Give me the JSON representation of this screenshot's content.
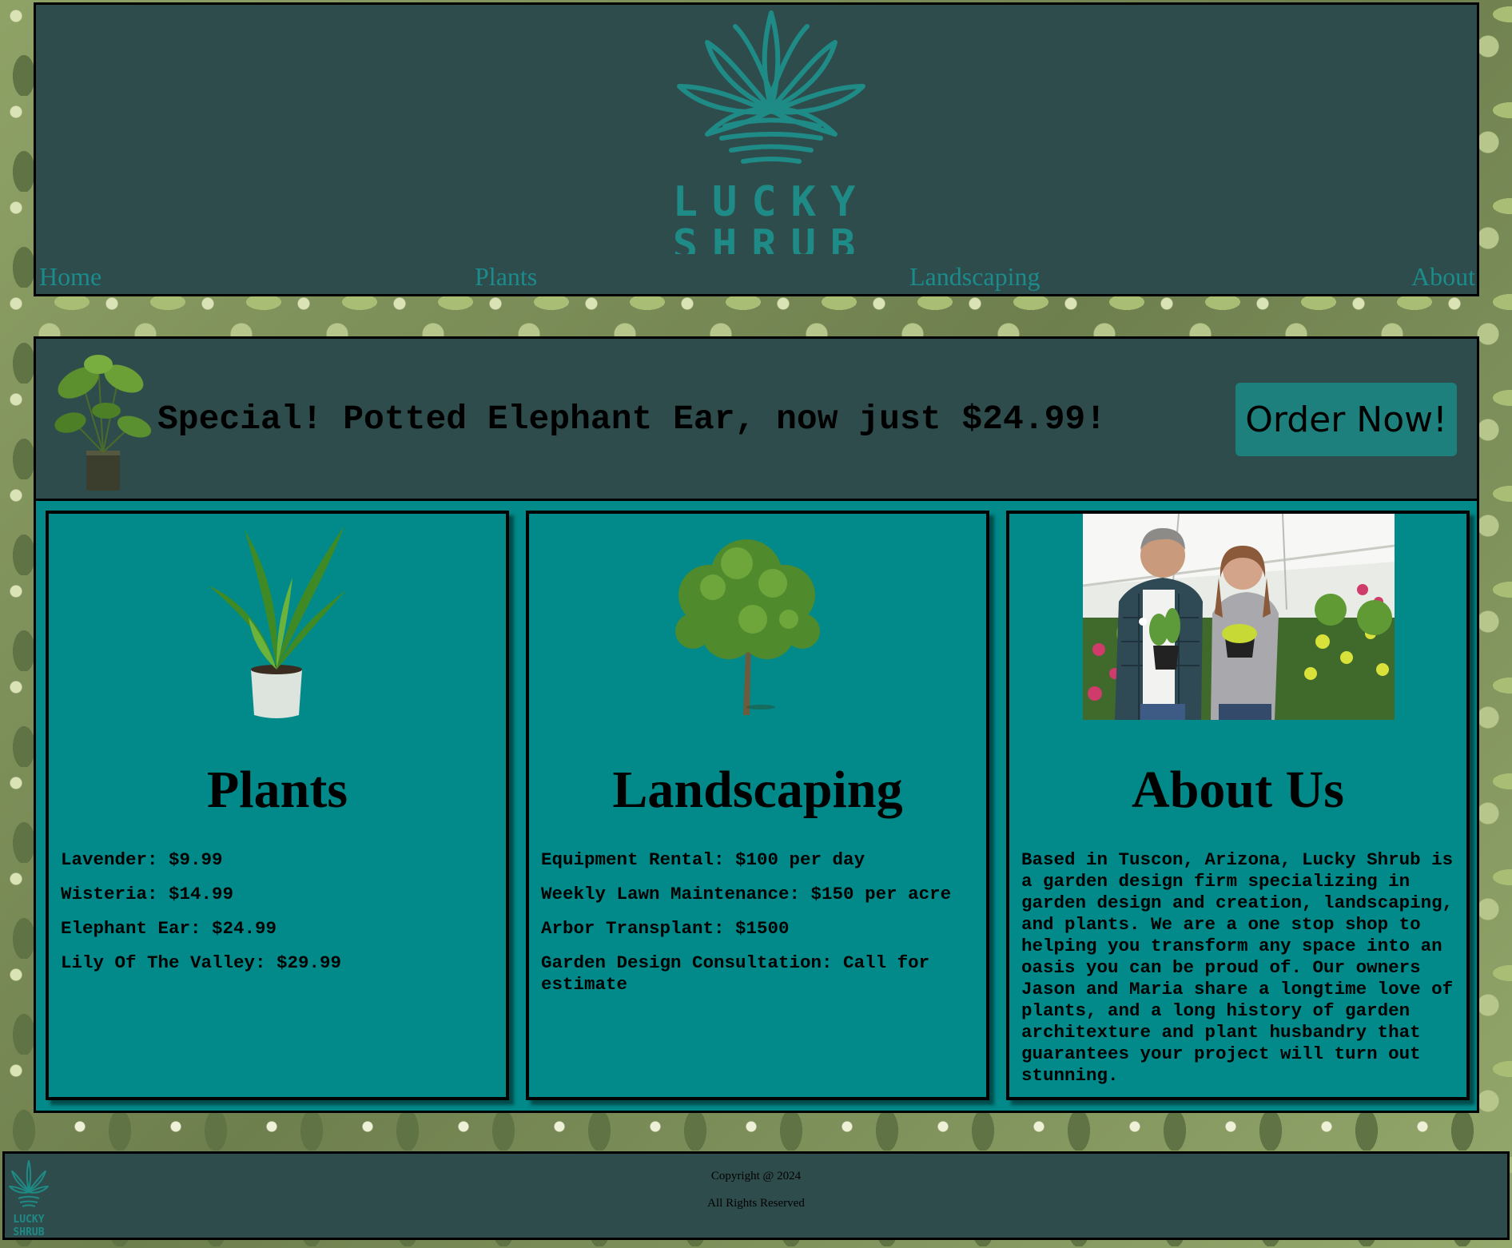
{
  "brand": {
    "line1": "LUCKY",
    "line2": "SHRUB",
    "logo_icon": "agave-plant-logo"
  },
  "nav": {
    "home": "Home",
    "plants": "Plants",
    "landscaping": "Landscaping",
    "about": "About"
  },
  "promo": {
    "text": "Special! Potted Elephant Ear, now just $24.99!",
    "button": "Order Now!"
  },
  "cards": {
    "plants": {
      "title": "Plants",
      "items": [
        "Lavender: $9.99",
        "Wisteria: $14.99",
        "Elephant Ear: $24.99",
        "Lily Of The Valley: $29.99"
      ]
    },
    "landscaping": {
      "title": "Landscaping",
      "items": [
        "Equipment Rental: $100 per day",
        "Weekly Lawn Maintenance: $150 per acre",
        "Arbor Transplant: $1500",
        "Garden Design Consultation: Call for estimate"
      ]
    },
    "about": {
      "title": "About Us",
      "text": "Based in Tuscon, Arizona, Lucky Shrub is a garden design firm specializing in garden design and creation, landscaping, and plants. We are a one stop shop to helping you transform any space into an oasis you can be proud of. Our owners Jason and Maria share a longtime love of plants, and a long history of garden architexture and plant husbandry that guarantees your project will turn out stunning."
    }
  },
  "footer": {
    "copyright": "Copyright @ 2024",
    "rights": "All Rights Reserved"
  },
  "colors": {
    "panel": "#2f4c4c",
    "teal": "#018a89",
    "accent": "#1b8b8b",
    "button": "#1e807d"
  }
}
